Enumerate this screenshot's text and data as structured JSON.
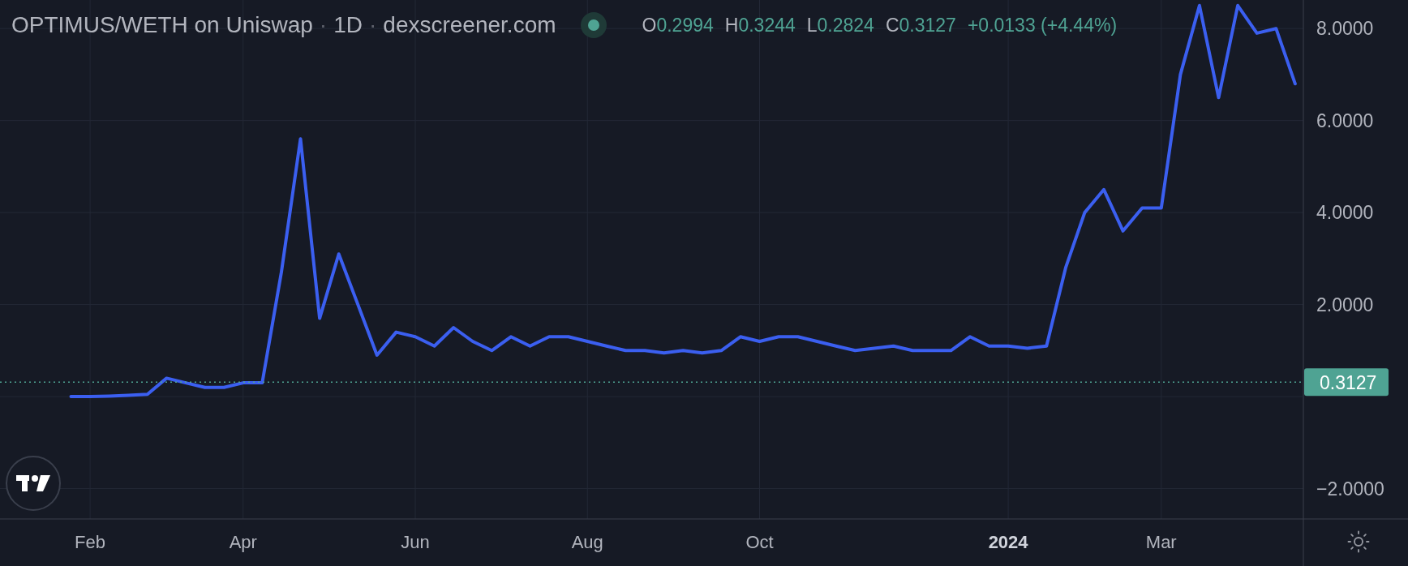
{
  "header": {
    "pair": "OPTIMUS/WETH on Uniswap",
    "separator": "·",
    "interval": "1D",
    "source": "dexscreener.com"
  },
  "ohlc": [
    {
      "label": "O",
      "value": "0.2994"
    },
    {
      "label": "H",
      "value": "0.3244"
    },
    {
      "label": "L",
      "value": "0.2824"
    },
    {
      "label": "C",
      "value": "0.3127"
    }
  ],
  "change": "+0.0133 (+4.44%)",
  "x_label_bold": [
    false,
    false,
    false,
    false,
    false,
    true,
    false
  ],
  "chart_data": {
    "type": "line",
    "ylim": [
      -2.66,
      8.62
    ],
    "grid": true,
    "ref_lines": [
      {
        "axis": "y",
        "value": 0.3127,
        "label": "0.3127",
        "color": "#4fa393"
      }
    ],
    "categories": [
      null,
      "Feb",
      null,
      null,
      null,
      null,
      null,
      null,
      null,
      "Apr",
      null,
      null,
      null,
      null,
      null,
      null,
      null,
      null,
      "Jun",
      null,
      null,
      null,
      null,
      null,
      null,
      null,
      null,
      "Aug",
      null,
      null,
      null,
      null,
      null,
      null,
      null,
      null,
      "Oct",
      null,
      null,
      null,
      null,
      null,
      null,
      null,
      null,
      null,
      null,
      null,
      null,
      "2024",
      null,
      null,
      null,
      null,
      null,
      null,
      null,
      "Mar",
      null,
      null,
      null,
      null,
      null,
      null,
      null
    ],
    "yticks": [
      {
        "value": -2,
        "label": "−2.0000"
      },
      {
        "value": 2,
        "label": "2.0000"
      },
      {
        "value": 4,
        "label": "4.0000"
      },
      {
        "value": 6,
        "label": "6.0000"
      },
      {
        "value": 8,
        "label": "8.0000"
      }
    ],
    "series": [
      {
        "color": "#3b5ff0",
        "values": [
          0.0,
          0.0,
          0.01,
          0.03,
          0.05,
          0.4,
          0.3,
          0.2,
          0.2,
          0.3,
          0.3,
          2.7,
          5.6,
          1.7,
          3.1,
          2.0,
          0.9,
          1.4,
          1.3,
          1.1,
          1.5,
          1.2,
          1.0,
          1.3,
          1.1,
          1.3,
          1.3,
          1.2,
          1.1,
          1.0,
          1.0,
          0.95,
          1.0,
          0.95,
          1.0,
          1.3,
          1.2,
          1.3,
          1.3,
          1.2,
          1.1,
          1.0,
          1.05,
          1.1,
          1.0,
          1.0,
          1.0,
          1.3,
          1.1,
          1.1,
          1.05,
          1.1,
          2.8,
          4.0,
          4.5,
          3.6,
          4.1,
          4.1,
          7.0,
          8.5,
          6.5,
          8.5,
          7.9,
          8.0,
          6.8
        ]
      }
    ]
  }
}
